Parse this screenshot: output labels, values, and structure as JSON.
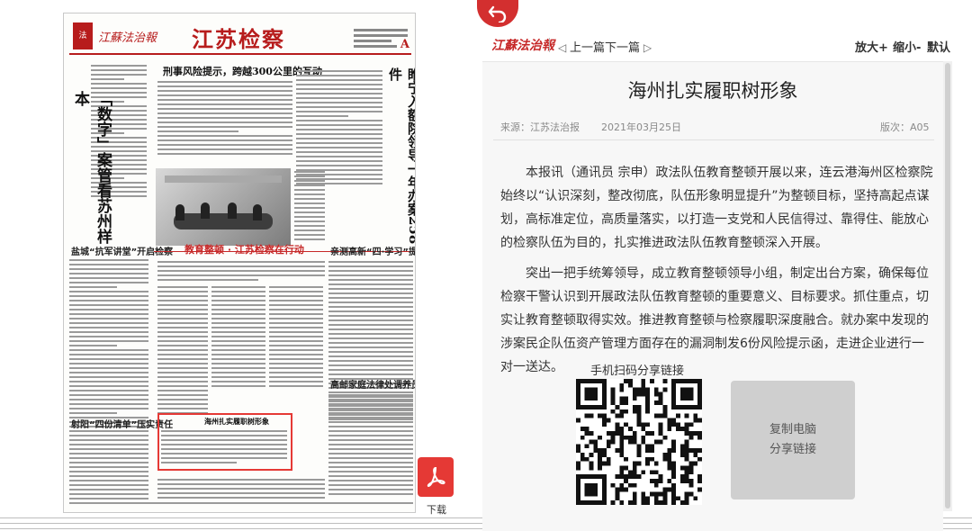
{
  "newspaper": {
    "brand": "江蘇法治報",
    "section_title": "江苏检察",
    "page_letter": "A",
    "headline_top": "刑事风险提示，跨越300公里的互动",
    "left_vertical_headline": "「数字」案管看苏州样本",
    "right_vertical_headline": "睢宁入额院领导一年办案258件",
    "section_banner": "教育整顿 · 江苏检察在行动",
    "sub_heads": [
      "盐城“抗军讲堂”开启检察",
      "海州扎实履职树形象",
      "亲测高新“四·学习”提成效",
      "射阳“四份清单”压实责任",
      "高邮家庭法律处调养员"
    ]
  },
  "nav": {
    "brand": "江蘇法治報",
    "prev": "上一篇",
    "next": "下一篇",
    "zoom_in": "放大+",
    "zoom_out": "缩小-",
    "default": "默认"
  },
  "article": {
    "title": "海州扎实履职树形象",
    "source": "来源：江苏法治报",
    "date": "2021年03月25日",
    "page_no": "版次：A05",
    "paragraphs": [
      "本报讯（通讯员 宗申）政法队伍教育整顿开展以来，连云港海州区检察院始终以“认识深刻，整改彻底，队伍形象明显提升”为整顿目标，坚持高起点谋划，高标准定位，高质量落实，以打造一支党和人民信得过、靠得住、能放心的检察队伍为目的，扎实推进政法队伍教育整顿深入开展。",
      "突出一把手统筹领导，成立教育整顿领导小组，制定出台方案，确保每位检察干警认识到开展政法队伍教育整顿的重要意义、目标要求。抓住重点，切实让教育整顿取得实效。推进教育整顿与检察履职深度融合。就办案中发现的涉案民企队伍资产管理方面存在的漏洞制发6份风险提示函，走进企业进行一对一送达。"
    ],
    "share_label": "手机扫码分享链接",
    "copy_line1": "复制电脑",
    "copy_line2": "分享链接"
  },
  "download": {
    "label": "下载"
  },
  "colors": {
    "accent": "#c62828",
    "pdf": "#e53935"
  }
}
